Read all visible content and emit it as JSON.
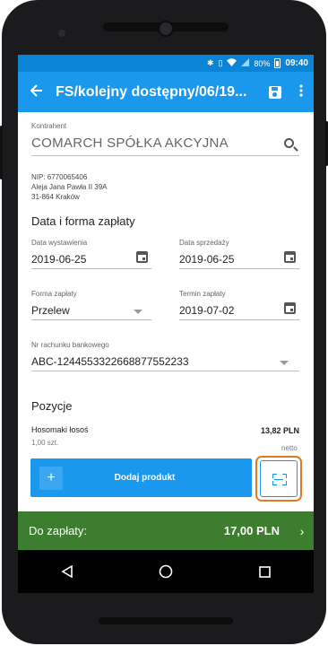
{
  "status_bar": {
    "battery_percent": "80%",
    "time": "09:40",
    "icons": [
      "bluetooth-icon",
      "vibrate-icon",
      "wifi-icon",
      "signal-icon",
      "battery-icon"
    ]
  },
  "app_bar": {
    "back_icon": "arrow-left-icon",
    "title": "FS/kolejny dostępny/06/19...",
    "save_icon": "save-icon",
    "more_icon": "more-vertical-icon"
  },
  "contractor": {
    "label": "Kontrahent",
    "value": "COMARCH SPÓŁKA AKCYJNA",
    "nip": "NIP:  6770065406",
    "address_line1": "Aleja Jana Pawła II  39A",
    "address_line2": "31-864  Kraków"
  },
  "payment_section": {
    "title": "Data i forma zapłaty",
    "issue_date_label": "Data wystawienia",
    "issue_date": "2019-06-25",
    "sale_date_label": "Data sprzedaży",
    "sale_date": "2019-06-25",
    "payment_method_label": "Forma zapłaty",
    "payment_method": "Przelew",
    "due_date_label": "Termin zapłaty",
    "due_date": "2019-07-02",
    "bank_account_label": "Nr rachunku bankowego",
    "bank_account": "ABC-1244553322668877552233"
  },
  "items_section": {
    "title": "Pozycje",
    "items": [
      {
        "name": "Hosomaki łosoś",
        "quantity": "1,00 szt.",
        "price": "13,82 PLN",
        "price_type": "netto"
      }
    ],
    "add_button_label": "Dodaj produkt"
  },
  "pay_bar": {
    "label": "Do zapłaty:",
    "amount": "17,00 PLN"
  },
  "colors": {
    "status_bar": "#0b84d6",
    "app_bar": "#1a98ee",
    "pay_bar": "#3d7d2f",
    "highlight": "#e07b1f"
  }
}
